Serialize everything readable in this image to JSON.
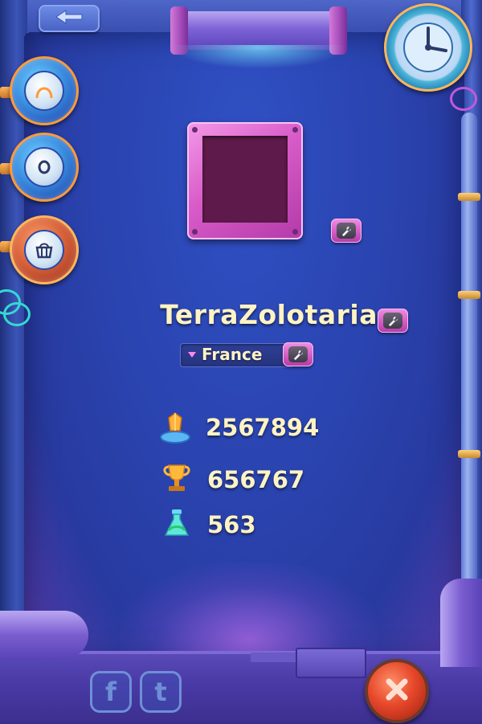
{
  "profile": {
    "name": "TerraZolotaria",
    "country": "France"
  },
  "stats": {
    "crystals": "2567894",
    "trophies": "656767",
    "potions": "563"
  },
  "social": {
    "facebook_glyph": "f",
    "tumblr_glyph": "t"
  },
  "icons": {
    "back": "back-arrow-icon",
    "clock": "clock-icon",
    "side_button_1": "helmet-icon",
    "side_button_2": "porthole-icon",
    "side_button_3": "shop-basket-icon",
    "edit": "wrench-icon",
    "crystal": "crystal-icon",
    "trophy": "trophy-icon",
    "potion": "potion-icon",
    "close": "close-icon"
  },
  "colors": {
    "text": "#fff3c4",
    "accent_pink": "#d85bc9",
    "panel_blue": "#2a44b0",
    "close_red": "#e6482a"
  }
}
